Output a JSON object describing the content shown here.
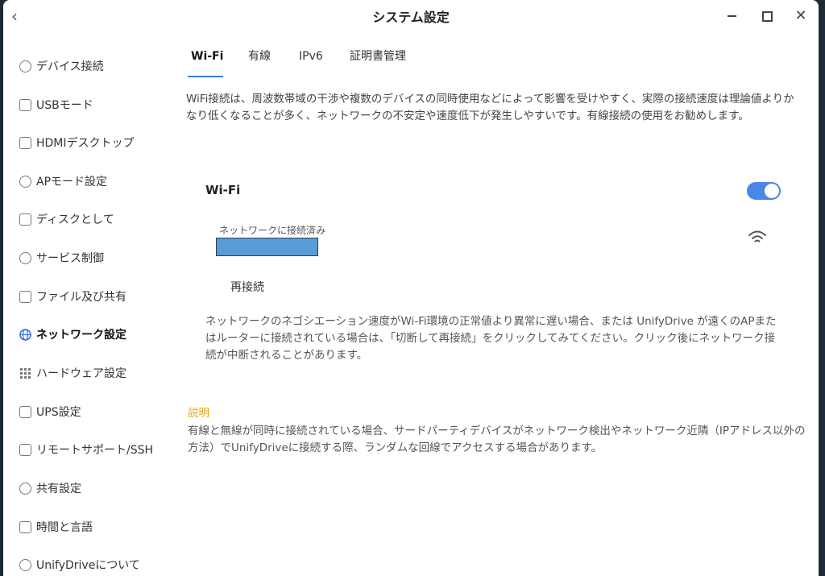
{
  "window": {
    "title": "システム設定"
  },
  "sidebar": {
    "items": [
      {
        "label": "デバイス接続",
        "icon": "link-icon"
      },
      {
        "label": "USBモード",
        "icon": "usb-icon"
      },
      {
        "label": "HDMIデスクトップ",
        "icon": "monitor-icon"
      },
      {
        "label": "APモード設定",
        "icon": "ap-icon"
      },
      {
        "label": "ディスクとして",
        "icon": "disk-icon"
      },
      {
        "label": "サービス制御",
        "icon": "toggle-icon"
      },
      {
        "label": "ファイル及び共有",
        "icon": "file-icon"
      },
      {
        "label": "ネットワーク設定",
        "icon": "globe-icon",
        "active": true
      },
      {
        "label": "ハードウェア設定",
        "icon": "grid-icon"
      },
      {
        "label": "UPS設定",
        "icon": "ups-icon"
      },
      {
        "label": "リモートサポート/SSH",
        "icon": "remote-icon"
      },
      {
        "label": "共有設定",
        "icon": "share-icon"
      },
      {
        "label": "時間と言語",
        "icon": "language-icon"
      },
      {
        "label": "UnifyDriveについて",
        "icon": "user-icon"
      }
    ]
  },
  "tabs": [
    {
      "label": "Wi-Fi",
      "active": true
    },
    {
      "label": "有線"
    },
    {
      "label": "IPv6"
    },
    {
      "label": "証明書管理"
    }
  ],
  "main": {
    "intro": "WiFi接続は、周波数帯域の干渉や複数のデバイスの同時使用などによって影響を受けやすく、実際の接続速度は理論値よりかなり低くなることが多く、ネットワークの不安定や速度低下が発生しやすいです。有線接続の使用をお勧めします。",
    "wifi_title": "Wi-Fi",
    "wifi_enabled": true,
    "connected_label": "ネットワークに接続済み",
    "reconnect_label": "再接続",
    "description": "ネットワークのネゴシエーション速度がWi-Fi環境の正常値より異常に遅い場合、または UnifyDrive が遠くのAPまたはルーターに接続されている場合は、「切断して再接続」をクリックしてみてください。クリック後にネットワーク接続が中断されることがあります。",
    "note_title": "説明",
    "note_body": "有線と無線が同時に接続されている場合、サードパーティデバイスがネットワーク検出やネットワーク近隣（IPアドレス以外の方法）でUnifyDriveに接続する際、ランダムな回線でアクセスする場合があります。"
  },
  "colors": {
    "accent": "#4a86e8",
    "note": "#e6a817",
    "ssid_mask": "#5b9bd5"
  }
}
